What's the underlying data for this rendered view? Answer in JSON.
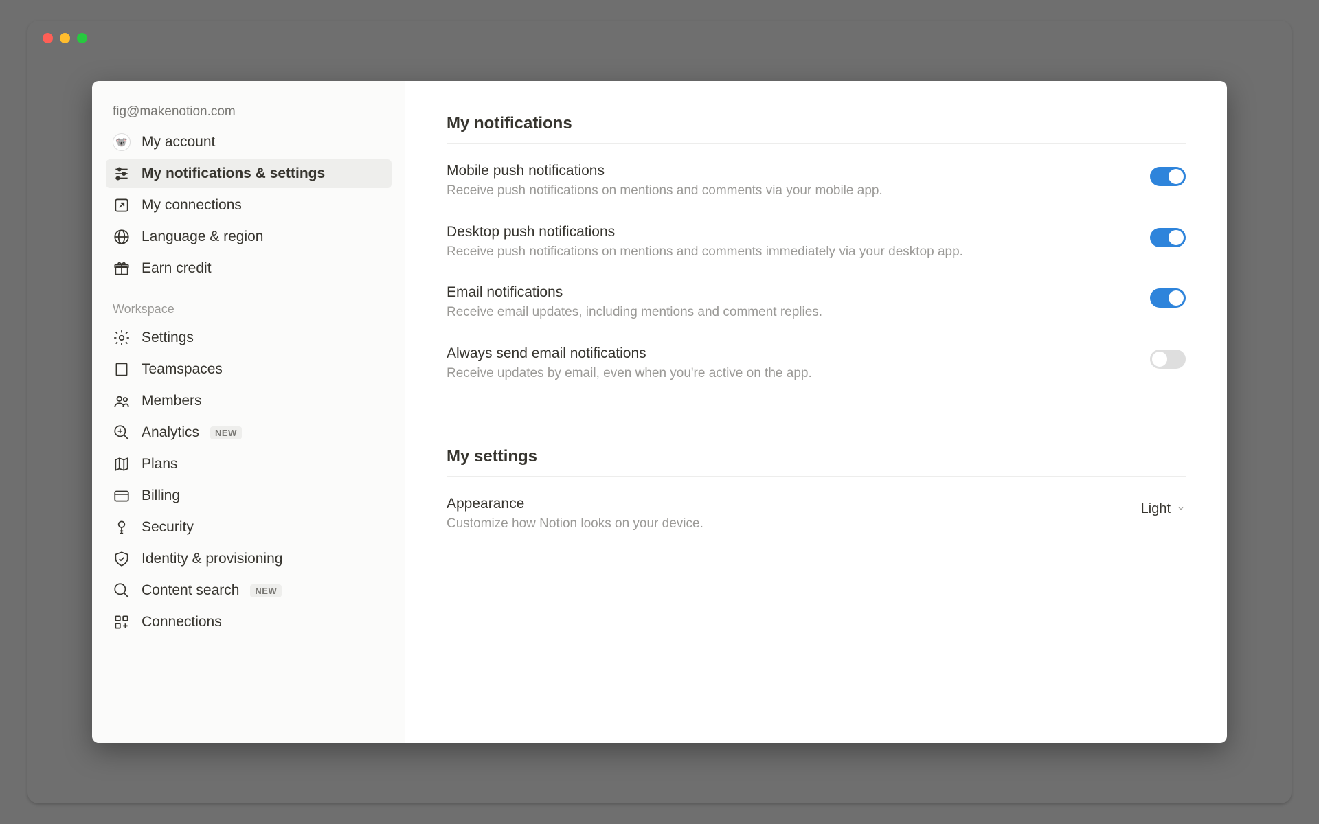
{
  "account_email": "fig@makenotion.com",
  "sidebar": {
    "account": [
      {
        "label": "My account",
        "icon": "avatar"
      },
      {
        "label": "My notifications & settings",
        "icon": "sliders"
      },
      {
        "label": "My connections",
        "icon": "external-link"
      },
      {
        "label": "Language & region",
        "icon": "globe"
      },
      {
        "label": "Earn credit",
        "icon": "gift"
      }
    ],
    "workspace_header": "Workspace",
    "workspace": [
      {
        "label": "Settings",
        "icon": "gear"
      },
      {
        "label": "Teamspaces",
        "icon": "building"
      },
      {
        "label": "Members",
        "icon": "people"
      },
      {
        "label": "Analytics",
        "icon": "magnify-plus",
        "badge": "NEW"
      },
      {
        "label": "Plans",
        "icon": "map"
      },
      {
        "label": "Billing",
        "icon": "card"
      },
      {
        "label": "Security",
        "icon": "key"
      },
      {
        "label": "Identity & provisioning",
        "icon": "shield-check"
      },
      {
        "label": "Content search",
        "icon": "search",
        "badge": "NEW"
      },
      {
        "label": "Connections",
        "icon": "grid-plus"
      }
    ]
  },
  "content": {
    "notifications_title": "My notifications",
    "settings_title": "My settings",
    "rows": [
      {
        "label": "Mobile push notifications",
        "desc": "Receive push notifications on mentions and comments via your mobile app.",
        "on": true
      },
      {
        "label": "Desktop push notifications",
        "desc": "Receive push notifications on mentions and comments immediately via your desktop app.",
        "on": true
      },
      {
        "label": "Email notifications",
        "desc": "Receive email updates, including mentions and comment replies.",
        "on": true
      },
      {
        "label": "Always send email notifications",
        "desc": "Receive updates by email, even when you're active on the app.",
        "on": false
      }
    ],
    "appearance": {
      "label": "Appearance",
      "desc": "Customize how Notion looks on your device.",
      "value": "Light"
    }
  }
}
